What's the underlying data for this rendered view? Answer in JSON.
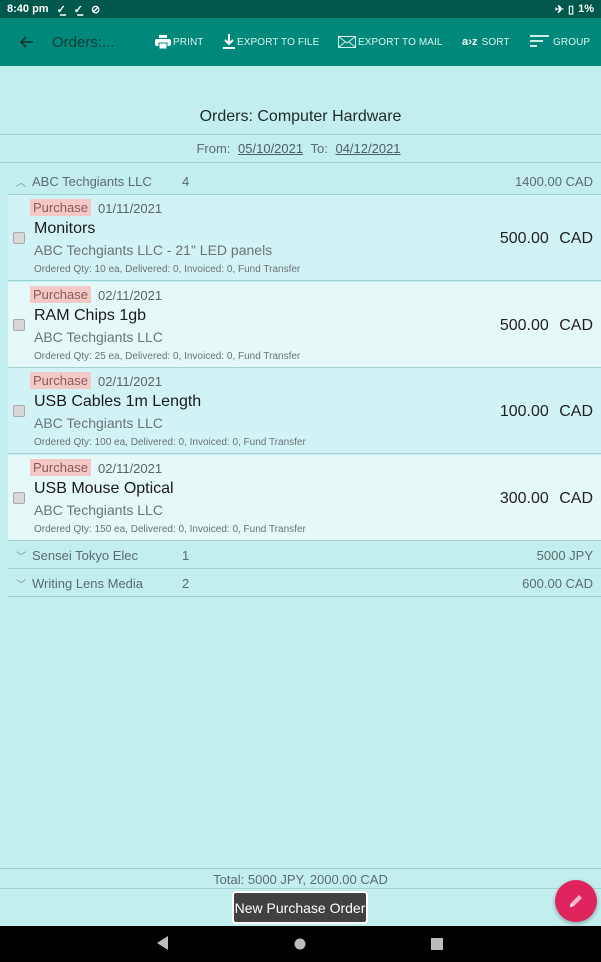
{
  "status_bar": {
    "time": "8:40 pm",
    "battery": "1%"
  },
  "toolbar": {
    "title": "Orders:...",
    "actions": [
      {
        "label": "PRINT",
        "icon": "print-icon"
      },
      {
        "label": "EXPORT TO FILE",
        "icon": "download-icon"
      },
      {
        "label": "EXPORT TO MAIL",
        "icon": "mail-icon"
      },
      {
        "label": "SORT",
        "icon": "sort-az-icon",
        "icon_text": "a›z"
      },
      {
        "label": "GROUP",
        "icon": "group-lines-icon"
      }
    ]
  },
  "report": {
    "title": "Orders: Computer Hardware",
    "from_label": "From:",
    "from_date": "05/10/2021",
    "to_label": "To:",
    "to_date": "04/12/2021"
  },
  "groups": [
    {
      "name": "ABC Techgiants LLC",
      "count": "4",
      "total": "1400.00 CAD",
      "expanded": true,
      "orders": [
        {
          "type": "Purchase",
          "date": "01/11/2021",
          "name": "Monitors",
          "supplier": "ABC Techgiants LLC - 21\" LED panels",
          "details": "Ordered Qty: 10 ea, Delivered: 0, Invoiced: 0, Fund Transfer",
          "amount": "500.00 CAD"
        },
        {
          "type": "Purchase",
          "date": "02/11/2021",
          "name": "RAM Chips 1gb",
          "supplier": "ABC Techgiants LLC",
          "details": "Ordered Qty: 25 ea, Delivered: 0, Invoiced: 0, Fund Transfer",
          "amount": "500.00 CAD"
        },
        {
          "type": "Purchase",
          "date": "02/11/2021",
          "name": "USB Cables 1m Length",
          "supplier": "ABC Techgiants LLC",
          "details": "Ordered Qty: 100 ea, Delivered: 0, Invoiced: 0, Fund Transfer",
          "amount": "100.00 CAD"
        },
        {
          "type": "Purchase",
          "date": "02/11/2021",
          "name": "USB Mouse Optical",
          "supplier": "ABC Techgiants LLC",
          "details": "Ordered Qty: 150 ea, Delivered: 0, Invoiced: 0, Fund Transfer",
          "amount": "300.00 CAD"
        }
      ]
    },
    {
      "name": "Sensei Tokyo Elec",
      "count": "1",
      "total": "5000 JPY",
      "expanded": false
    },
    {
      "name": "Writing Lens Media",
      "count": "2",
      "total": "600.00 CAD",
      "expanded": false
    }
  ],
  "footer": {
    "total": "Total: 5000 JPY, 2000.00 CAD",
    "new_button": "New Purchase Order"
  },
  "colors": {
    "toolbar": "#00897b",
    "status_bar": "#00574b",
    "background": "#c2eeee",
    "fab": "#e0245e",
    "badge": "#f5c8c8"
  }
}
